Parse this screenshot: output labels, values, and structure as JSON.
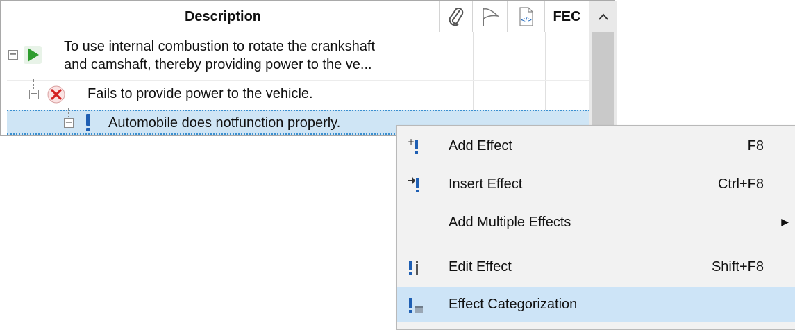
{
  "grid": {
    "columns": {
      "description": "Description",
      "attachment_icon": "paperclip-icon",
      "flag_icon": "flag-icon",
      "code_icon": "code-file-icon",
      "fec": "FEC"
    },
    "rows": [
      {
        "icon": "play-icon",
        "line1": "To use internal combustion to rotate the crankshaft",
        "line2": "and camshaft, thereby providing power to the ve..."
      },
      {
        "icon": "failure-x-icon",
        "text": "Fails to provide power to the vehicle."
      },
      {
        "icon": "effect-exclamation-icon",
        "text": "Automobile does notfunction properly.",
        "selected": true
      }
    ],
    "scroll_up": "scroll-up-arrow"
  },
  "context_menu": {
    "items": [
      {
        "label": "Add Effect",
        "shortcut": "F8",
        "icon": "add-effect-icon"
      },
      {
        "label": "Insert Effect",
        "shortcut": "Ctrl+F8",
        "icon": "insert-effect-icon"
      },
      {
        "label": "Add Multiple Effects",
        "shortcut": "",
        "submenu": true
      },
      {
        "label": "Edit Effect",
        "shortcut": "Shift+F8",
        "icon": "edit-effect-icon"
      },
      {
        "label": "Effect Categorization",
        "shortcut": "",
        "icon": "effect-categorization-icon",
        "highlighted": true
      }
    ]
  },
  "colors": {
    "selection": "#cfe5f5",
    "menu_highlight": "#cde4f7",
    "play_green": "#2e9d2e",
    "fail_red": "#d42020",
    "effect_blue": "#1f5fb3"
  }
}
